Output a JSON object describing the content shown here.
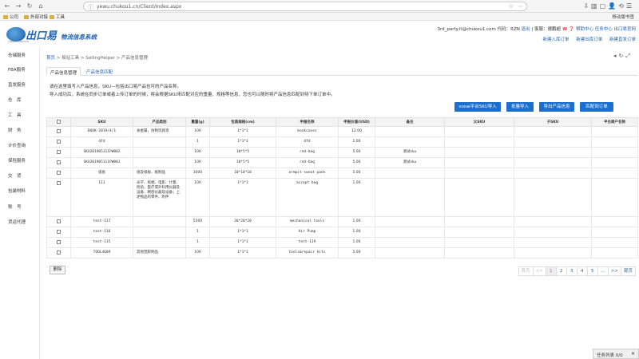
{
  "browser": {
    "url": "yewu.chukou1.cn/Client/Index.aspx",
    "bookmarks": [
      "公司",
      "外部对接",
      "工具"
    ],
    "mobile_bookmarks": "移动版书签"
  },
  "header": {
    "brand": "出口易",
    "subtitle": "物流信息系统",
    "brand_tiny": "CHUKOU1 LOGISTICS",
    "user_text": "3rd_party.it@chukou1.com  代码：RZN",
    "logout": "退出",
    "service_text": "| 客服：德鹏超",
    "help_center": "帮助中心",
    "task_center": "任务中心",
    "ck1_home": "出口易官网",
    "quick_actions": [
      "新建入库订单",
      "新建出库订单",
      "新建直发订单"
    ]
  },
  "sidebar": {
    "items": [
      "仓储服务",
      "FBA服务",
      "直发服务",
      "仓　库",
      "工　具",
      "财　务",
      "计价查询",
      "保险服务",
      "交　货",
      "包装材料",
      "账　号",
      "货运代理"
    ]
  },
  "breadcrumb": {
    "home": "首页",
    "rest": " > 易站工具 > SellingHelper > 产品信息管理"
  },
  "tabs": [
    "产品信息管理",
    "产品信息匹配"
  ],
  "notes": [
    "请在这里填写入产品信息，SKU—包括出口易产品也可的产品名称。",
    "导入成功后，系统在同步订单或者上传订单的时候，将会根据SKU来匹配对应的重量、规格等信息，您也可以随时将产品信息匹配到待下单订单中。"
  ],
  "buttons": [
    "voxai平台SKU导入",
    "批量导入",
    "导出产品信息",
    "匹配到订单"
  ],
  "table": {
    "headers": [
      "",
      "SKU",
      "产品类别",
      "重量(g)",
      "包装规格(cm)",
      "申报名称",
      "申报价值(USD)",
      "备注",
      "父SKU",
      "子SKU",
      "平台商户名称"
    ],
    "rows": [
      [
        "",
        "BOOK-2019/4/1",
        "食金属，仿制玩具等",
        "100",
        "1*1*1",
        "bookcases",
        "12.00",
        "",
        "",
        "",
        ""
      ],
      [
        "",
        "dfd",
        "",
        "1",
        "1*1*1",
        "dfd",
        "1.00",
        "",
        "",
        "",
        ""
      ],
      [
        "",
        "SKU201905111PW002",
        "",
        "100",
        "10*5*5",
        "red-bag",
        "5.00",
        "测试sku",
        "",
        "",
        ""
      ],
      [
        "",
        "SKU201905111PW001",
        "",
        "100",
        "10*5*5",
        "red-bag",
        "5.00",
        "测试sku",
        "",
        "",
        ""
      ],
      [
        "",
        "纸张",
        "纸及纸板、纸制品",
        "3000",
        "10*10*10",
        "armpit sweat pads",
        "5.00",
        "",
        "",
        "",
        ""
      ],
      [
        "",
        "111",
        "光学、照相、电影、计量、检验、医疗或外科用仪器及设备、精密仪器及设备；上述物品的零件、附件",
        "100",
        "1*1*1",
        "accept bag",
        "1.00",
        "",
        "",
        "",
        ""
      ],
      [
        "",
        "test-117",
        "",
        "5500",
        "30*20*20",
        "mechanical tools",
        "1.00",
        "",
        "",
        "",
        ""
      ],
      [
        "",
        "test-116",
        "",
        "1",
        "1*1*1",
        "Air Pump",
        "1.00",
        "",
        "",
        "",
        ""
      ],
      [
        "",
        "test-115",
        "",
        "1",
        "1*1*1",
        "test-119",
        "1.00",
        "",
        "",
        "",
        ""
      ],
      [
        "",
        "TOOL4609",
        "其他塑胶制品",
        "100",
        "1*1*1",
        "tools&repair kits",
        "5.00",
        "",
        "",
        "",
        ""
      ]
    ]
  },
  "delete_button": "删除",
  "pager": [
    "首页",
    "<<",
    "1",
    "2",
    "3",
    "4",
    "5",
    "...",
    ">>",
    "尾页"
  ],
  "taskbar": {
    "label": "任务列表 0/0",
    "close": "✕"
  }
}
